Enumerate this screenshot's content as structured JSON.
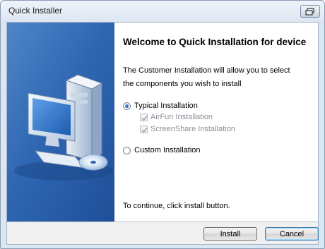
{
  "window": {
    "title": "Quick Installer"
  },
  "content": {
    "heading": "Welcome to Quick Installation for device",
    "description_line1": "The Customer Installation will allow you to select",
    "description_line2": "the components you wish to install",
    "options": {
      "typical": {
        "label": "Typical Installation",
        "selected": true
      },
      "airfun": {
        "label": "AirFun Installation",
        "checked": true,
        "enabled": false
      },
      "screenshare": {
        "label": "ScreenShare Installation",
        "checked": true,
        "enabled": false
      },
      "custom": {
        "label": "Custom Installation",
        "selected": false
      }
    },
    "footer_note": "To continue, click install button."
  },
  "buttons": {
    "install": "Install",
    "cancel": "Cancel"
  },
  "icons": {
    "system_menu": "restore-icon",
    "banner": "computer-install-icon"
  },
  "colors": {
    "banner": "#2f67b2",
    "default_button_border": "#3c7fb1"
  }
}
